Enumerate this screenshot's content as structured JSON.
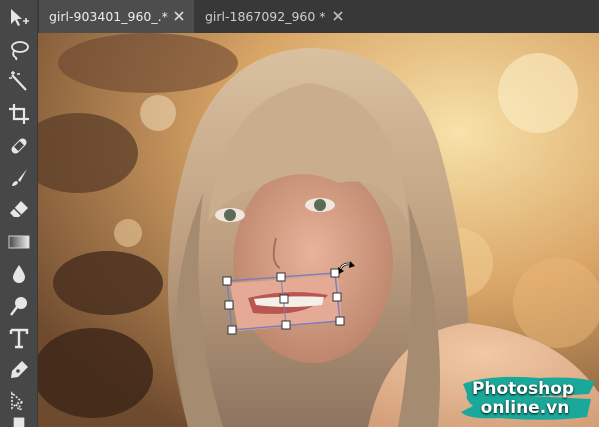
{
  "tabs": [
    {
      "title": "girl-903401_960_.*",
      "active": true
    },
    {
      "title": "girl-1867092_960 *",
      "active": false
    }
  ],
  "tools": [
    {
      "name": "move-tool",
      "icon": "move-arrow-icon"
    },
    {
      "name": "lasso-tool",
      "icon": "lasso-icon"
    },
    {
      "name": "magic-wand-tool",
      "icon": "magic-wand-icon"
    },
    {
      "name": "crop-tool",
      "icon": "crop-icon"
    },
    {
      "name": "healing-tool",
      "icon": "bandage-icon"
    },
    {
      "name": "brush-tool",
      "icon": "brush-icon"
    },
    {
      "name": "eraser-tool",
      "icon": "eraser-icon"
    },
    {
      "name": "gradient-tool",
      "icon": "gradient-icon"
    },
    {
      "name": "blur-tool",
      "icon": "drop-icon"
    },
    {
      "name": "dodge-tool",
      "icon": "dodge-icon"
    },
    {
      "name": "type-tool",
      "icon": "type-T-icon"
    },
    {
      "name": "pen-tool",
      "icon": "pen-icon"
    },
    {
      "name": "selection-tool",
      "icon": "direct-select-icon"
    },
    {
      "name": "rectangle-tool",
      "icon": "rectangle-icon"
    }
  ],
  "watermark": {
    "line1": "Photoshop",
    "line2": "online.vn",
    "color": "#1aa89a"
  },
  "colors": {
    "toolbar": "#474747",
    "tabbar": "#383838",
    "active_tab": "#4d4d4d",
    "transform_box": "#7b7fb8"
  }
}
